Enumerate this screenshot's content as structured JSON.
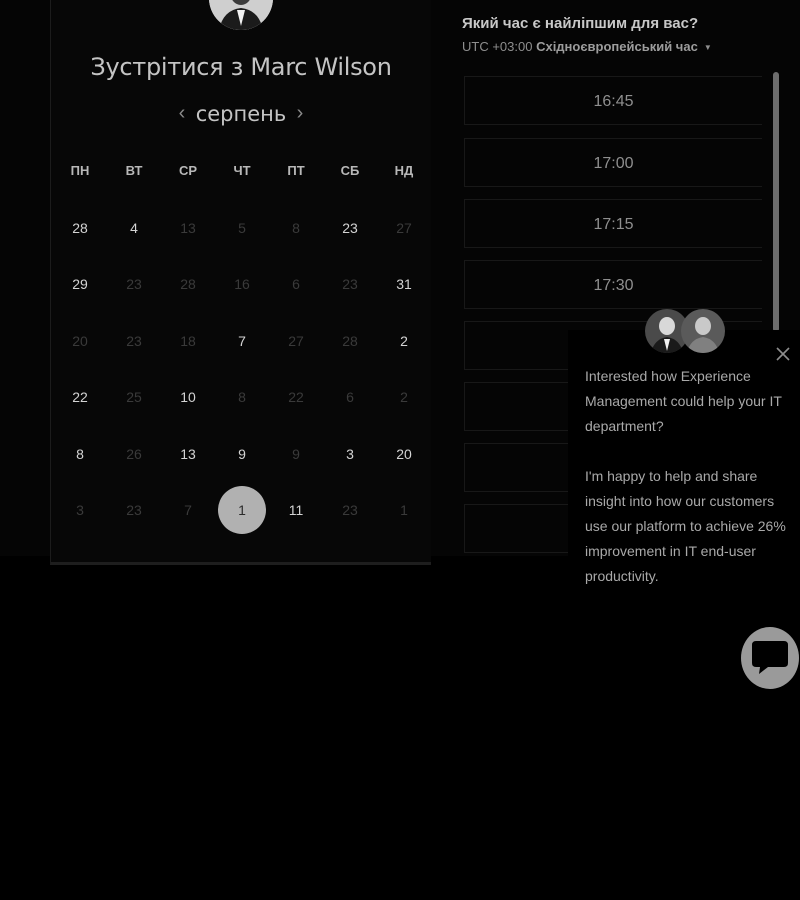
{
  "calendar": {
    "title": "Зустрітися з Marc Wilson",
    "month": "серпень",
    "prev_label": "‹",
    "next_label": "›",
    "weekdays": [
      "ПН",
      "ВТ",
      "СР",
      "ЧТ",
      "ПТ",
      "СБ",
      "НД"
    ],
    "weeks": [
      [
        {
          "d": "28",
          "on": true
        },
        {
          "d": "4",
          "on": true
        },
        {
          "d": "13",
          "on": false
        },
        {
          "d": "5",
          "on": false
        },
        {
          "d": "8",
          "on": false
        },
        {
          "d": "23",
          "on": true
        },
        {
          "d": "27",
          "on": false
        }
      ],
      [
        {
          "d": "29",
          "on": true
        },
        {
          "d": "23",
          "on": false
        },
        {
          "d": "28",
          "on": false
        },
        {
          "d": "16",
          "on": false
        },
        {
          "d": "6",
          "on": false
        },
        {
          "d": "23",
          "on": false
        },
        {
          "d": "31",
          "on": true
        }
      ],
      [
        {
          "d": "20",
          "on": false
        },
        {
          "d": "23",
          "on": false
        },
        {
          "d": "18",
          "on": false
        },
        {
          "d": "7",
          "on": true
        },
        {
          "d": "27",
          "on": false
        },
        {
          "d": "28",
          "on": false
        },
        {
          "d": "2",
          "on": true
        }
      ],
      [
        {
          "d": "22",
          "on": true
        },
        {
          "d": "25",
          "on": false
        },
        {
          "d": "10",
          "on": true
        },
        {
          "d": "8",
          "on": false
        },
        {
          "d": "22",
          "on": false
        },
        {
          "d": "6",
          "on": false
        },
        {
          "d": "2",
          "on": false
        }
      ],
      [
        {
          "d": "8",
          "on": true
        },
        {
          "d": "26",
          "on": false
        },
        {
          "d": "13",
          "on": true
        },
        {
          "d": "9",
          "on": true
        },
        {
          "d": "9",
          "on": false
        },
        {
          "d": "3",
          "on": true
        },
        {
          "d": "20",
          "on": true
        }
      ],
      [
        {
          "d": "3",
          "on": false
        },
        {
          "d": "23",
          "on": false
        },
        {
          "d": "7",
          "on": false
        },
        {
          "d": "1",
          "on": true,
          "selected": true
        },
        {
          "d": "11",
          "on": true
        },
        {
          "d": "23",
          "on": false
        },
        {
          "d": "1",
          "on": false
        }
      ]
    ]
  },
  "times": {
    "question": "Який час є найліпшим для вас?",
    "tz_offset": "UTC +03:00",
    "tz_name": "Східноєвропейський час",
    "slots": [
      "16:45",
      "17:00",
      "17:15",
      "17:30",
      "",
      "",
      "",
      ""
    ]
  },
  "chat": {
    "paragraph1": "Interested how Experience Management could help your IT department?",
    "paragraph2": "I'm happy to help and share insight into how our customers use our platform to achieve 26% improvement in IT end-user productivity."
  },
  "colors": {
    "selected_day": "#b1b1b1",
    "background": "#000000"
  }
}
